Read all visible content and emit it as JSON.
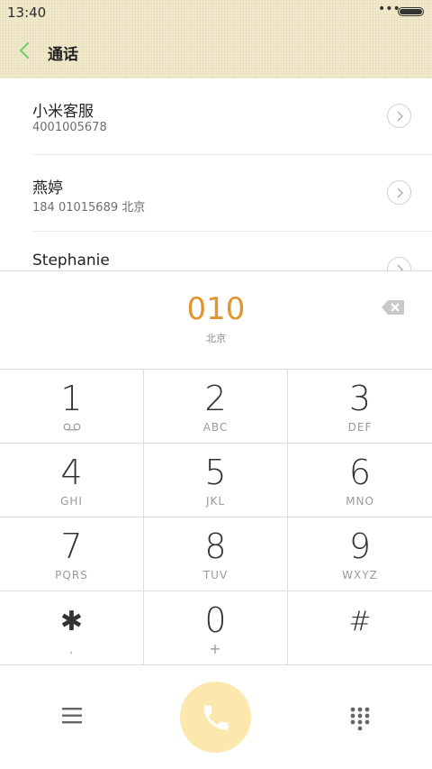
{
  "status_bar": {
    "time": "13:40",
    "dots": "•••"
  },
  "header": {
    "title": "通话"
  },
  "contacts": [
    {
      "name": "小米客服",
      "detail": "4001005678"
    },
    {
      "name": "燕婷",
      "detail": "184 01015689  北京"
    },
    {
      "name": "Stephanie",
      "detail": ""
    }
  ],
  "dialer": {
    "input_number": "010",
    "location": "北京"
  },
  "keypad": [
    {
      "digit": "1",
      "letters": ""
    },
    {
      "digit": "2",
      "letters": "ABC"
    },
    {
      "digit": "3",
      "letters": "DEF"
    },
    {
      "digit": "4",
      "letters": "GHI"
    },
    {
      "digit": "5",
      "letters": "JKL"
    },
    {
      "digit": "6",
      "letters": "MNO"
    },
    {
      "digit": "7",
      "letters": "PQRS"
    },
    {
      "digit": "8",
      "letters": "TUV"
    },
    {
      "digit": "9",
      "letters": "WXYZ"
    },
    {
      "digit": "✱",
      "letters": ","
    },
    {
      "digit": "0",
      "letters": "+"
    },
    {
      "digit": "#",
      "letters": ""
    }
  ],
  "colors": {
    "accent": "#e0962f",
    "call_button": "#fce8ad",
    "back_arrow": "#6fcf6f",
    "header_bg": "#efe6c6"
  },
  "icons": {
    "back": "back-arrow-icon",
    "chevron": "chevron-right-icon",
    "backspace": "backspace-icon",
    "voicemail": "voicemail-icon",
    "menu": "menu-icon",
    "call": "phone-icon",
    "dialpad": "dialpad-icon"
  }
}
